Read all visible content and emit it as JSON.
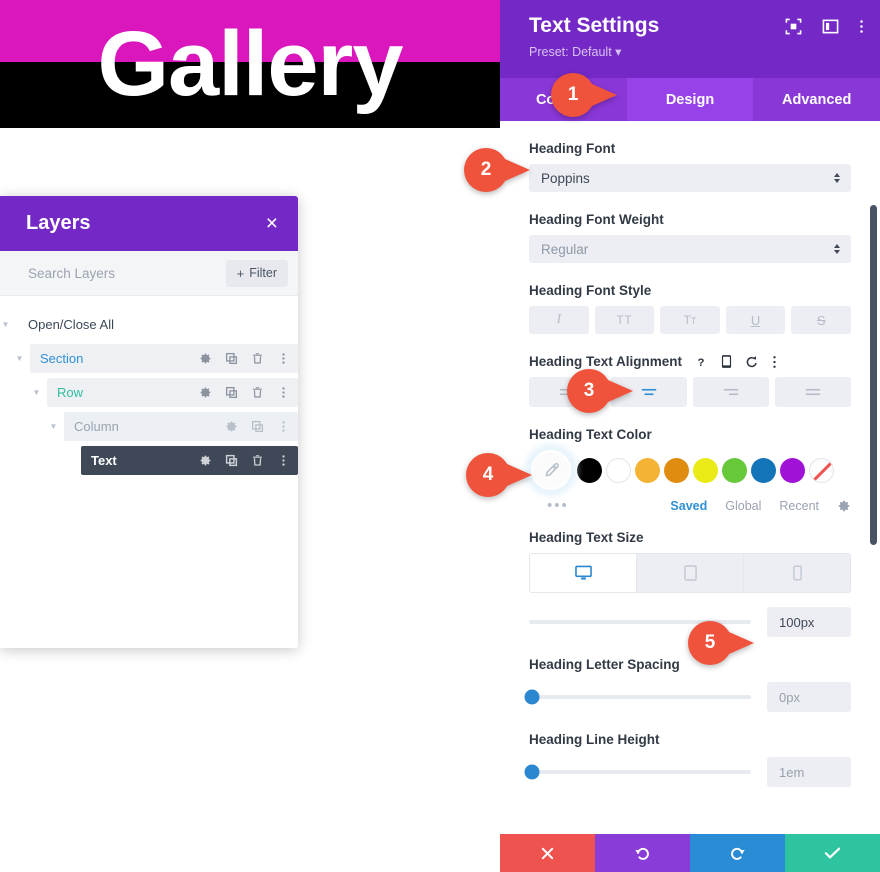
{
  "canvas": {
    "heading_text": "Gallery",
    "band_top_color": "#da16bd",
    "band_bottom_color": "#000000"
  },
  "layers": {
    "title": "Layers",
    "close_label": "×",
    "search_placeholder": "Search Layers",
    "search_value": "",
    "filter_label": "Filter",
    "filter_plus": "+",
    "open_close_all": "Open/Close All",
    "rows": [
      {
        "label": "Section",
        "icons": [
          "gear",
          "duplicate",
          "trash",
          "dots"
        ]
      },
      {
        "label": "Row",
        "icons": [
          "gear",
          "duplicate",
          "trash",
          "dots"
        ]
      },
      {
        "label": "Column",
        "icons": [
          "gear",
          "duplicate",
          "dots"
        ]
      },
      {
        "label": "Text",
        "icons": [
          "gear",
          "duplicate",
          "trash",
          "dots"
        ]
      }
    ]
  },
  "settings": {
    "title": "Text Settings",
    "preset": "Preset: Default",
    "preset_caret": "▾",
    "header_icons": [
      "focus-frame-icon",
      "panel-layout-icon",
      "vertical-dots-icon"
    ],
    "tabs": [
      {
        "label": "Content",
        "active": false
      },
      {
        "label": "Design",
        "active": true
      },
      {
        "label": "Advanced",
        "active": false
      }
    ],
    "fields": {
      "heading_font": {
        "label": "Heading Font",
        "value": "Poppins"
      },
      "heading_font_weight": {
        "label": "Heading Font Weight",
        "value": "Regular"
      },
      "heading_font_style": {
        "label": "Heading Font Style",
        "buttons": [
          "I",
          "TT",
          "Tт",
          "U",
          "S"
        ]
      },
      "heading_text_alignment": {
        "label": "Heading Text Alignment",
        "inline_icons": [
          "help-icon",
          "responsive-icon",
          "reset-icon",
          "options-icon"
        ],
        "options": [
          "left",
          "center",
          "right",
          "justify"
        ],
        "active_index": 1
      },
      "heading_text_color": {
        "label": "Heading Text Color",
        "picker_icon": "eyedropper-icon",
        "more_dots": "•••",
        "swatches": [
          "#000000",
          "#ffffff",
          "#f5b335",
          "#e08c10",
          "#e9ea16",
          "#67c93a",
          "#1474b8",
          "#a013d6",
          "none"
        ],
        "tabs": [
          {
            "label": "Saved",
            "active": true
          },
          {
            "label": "Global",
            "active": false
          },
          {
            "label": "Recent",
            "active": false
          }
        ],
        "gear_icon": "gear-icon"
      },
      "heading_text_size": {
        "label": "Heading Text Size",
        "devices": [
          "desktop",
          "tablet",
          "phone"
        ],
        "active_device": 0,
        "value": "100px",
        "slider_percent": 72
      },
      "heading_letter_spacing": {
        "label": "Heading Letter Spacing",
        "value": "0px",
        "slider_percent": 0
      },
      "heading_line_height": {
        "label": "Heading Line Height",
        "value": "1em",
        "slider_percent": 0
      }
    },
    "footer_buttons": [
      {
        "name": "cancel",
        "icon": "close-icon",
        "color": "#ef5350"
      },
      {
        "name": "undo",
        "icon": "undo-icon",
        "color": "#8a3cd8"
      },
      {
        "name": "redo",
        "icon": "redo-icon",
        "color": "#2a8cd4"
      },
      {
        "name": "save",
        "icon": "check-icon",
        "color": "#2ec4a0"
      }
    ]
  },
  "callouts": [
    {
      "number": "1"
    },
    {
      "number": "2"
    },
    {
      "number": "3"
    },
    {
      "number": "4"
    },
    {
      "number": "5"
    }
  ]
}
